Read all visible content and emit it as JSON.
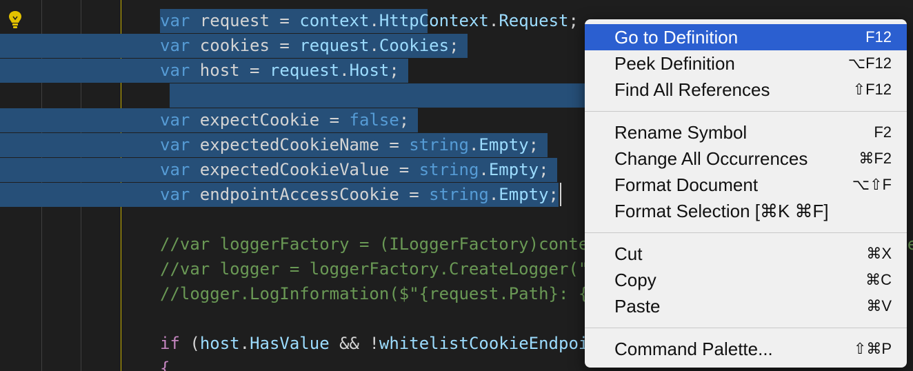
{
  "editor": {
    "lines": [
      [
        {
          "t": "var",
          "c": "kw"
        },
        {
          "t": " request = "
        },
        {
          "t": "context",
          "c": "var"
        },
        {
          "t": "."
        },
        {
          "t": "HttpContext",
          "c": "var"
        },
        {
          "t": "."
        },
        {
          "t": "Request",
          "c": "var"
        },
        {
          "t": ";"
        }
      ],
      [
        {
          "t": "var",
          "c": "kw"
        },
        {
          "t": " cookies = "
        },
        {
          "t": "request",
          "c": "var"
        },
        {
          "t": "."
        },
        {
          "t": "Cookies",
          "c": "var"
        },
        {
          "t": ";"
        }
      ],
      [
        {
          "t": "var",
          "c": "kw"
        },
        {
          "t": " host = "
        },
        {
          "t": "request",
          "c": "var"
        },
        {
          "t": "."
        },
        {
          "t": "Host",
          "c": "var"
        },
        {
          "t": ";"
        }
      ],
      [],
      [
        {
          "t": "var",
          "c": "kw"
        },
        {
          "t": " expectCookie = "
        },
        {
          "t": "false",
          "c": "kw"
        },
        {
          "t": ";"
        }
      ],
      [
        {
          "t": "var",
          "c": "kw"
        },
        {
          "t": " expectedCookieName = "
        },
        {
          "t": "string",
          "c": "kw"
        },
        {
          "t": "."
        },
        {
          "t": "Empty",
          "c": "var"
        },
        {
          "t": ";"
        }
      ],
      [
        {
          "t": "var",
          "c": "kw"
        },
        {
          "t": " expectedCookieValue = "
        },
        {
          "t": "string",
          "c": "kw"
        },
        {
          "t": "."
        },
        {
          "t": "Empty",
          "c": "var"
        },
        {
          "t": ";"
        }
      ],
      [
        {
          "t": "var",
          "c": "kw"
        },
        {
          "t": " endpointAccessCookie = "
        },
        {
          "t": "string",
          "c": "kw"
        },
        {
          "t": "."
        },
        {
          "t": "Empty",
          "c": "var"
        },
        {
          "t": ";"
        }
      ],
      [],
      [
        {
          "t": "//var loggerFactory = (ILoggerFactory)context.HttpContext.RequestServices.GetService(typeof(ILoggerFactory));",
          "c": "com"
        }
      ],
      [
        {
          "t": "//var logger = loggerFactory.CreateLogger(\"",
          "c": "com"
        }
      ],
      [
        {
          "t": "//logger.LogInformation($\"{request.Path}: {",
          "c": "com"
        }
      ],
      [],
      [
        {
          "t": "if",
          "c": "kw2"
        },
        {
          "t": " ("
        },
        {
          "t": "host",
          "c": "var"
        },
        {
          "t": "."
        },
        {
          "t": "HasValue",
          "c": "var"
        },
        {
          "t": " && !"
        },
        {
          "t": "whitelistCookieEndpoints",
          "c": "var"
        }
      ],
      [
        {
          "t": "{",
          "c": "kw2"
        }
      ]
    ]
  },
  "context_menu": {
    "items": [
      {
        "label": "Go to Definition",
        "shortcut": "F12",
        "active": true
      },
      {
        "label": "Peek Definition",
        "shortcut": "⌥F12"
      },
      {
        "label": "Find All References",
        "shortcut": "⇧F12"
      },
      {
        "label": "Rename Symbol",
        "shortcut": "F2"
      },
      {
        "label": "Change All Occurrences",
        "shortcut": "⌘F2"
      },
      {
        "label": "Format Document",
        "shortcut": "⌥⇧F"
      },
      {
        "label": "Format Selection [⌘K ⌘F]",
        "shortcut": ""
      },
      {
        "label": "Cut",
        "shortcut": "⌘X"
      },
      {
        "label": "Copy",
        "shortcut": "⌘C"
      },
      {
        "label": "Paste",
        "shortcut": "⌘V"
      },
      {
        "label": "Command Palette...",
        "shortcut": "⇧⌘P"
      }
    ]
  },
  "colors": {
    "editor_bg": "#1e1e1e",
    "selection": "#264f78",
    "menu_bg": "#f0f0f0",
    "menu_active": "#2b5fd0"
  }
}
